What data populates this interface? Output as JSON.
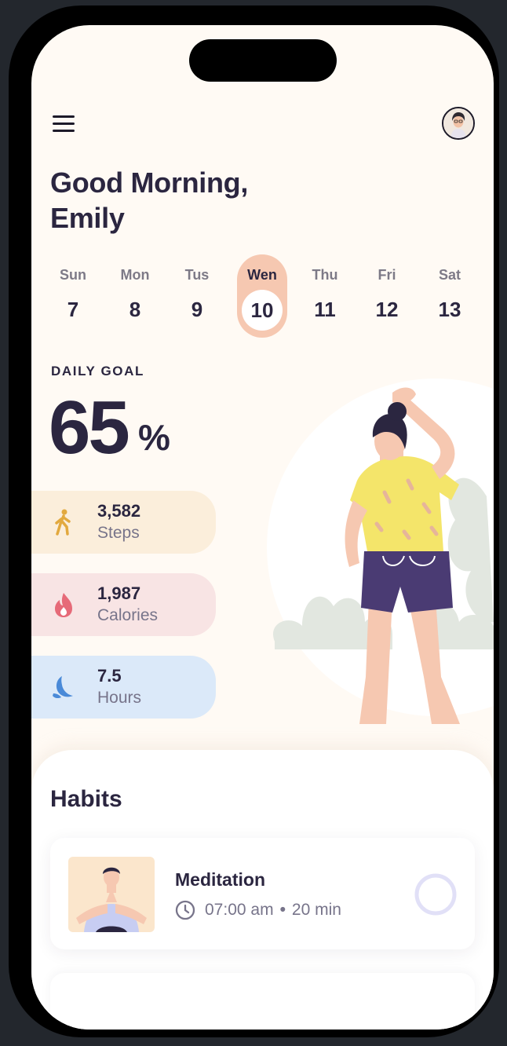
{
  "user": {
    "greeting": "Good Morning,",
    "name": "Emily"
  },
  "week": [
    {
      "name": "Sun",
      "date": "7"
    },
    {
      "name": "Mon",
      "date": "8"
    },
    {
      "name": "Tus",
      "date": "9"
    },
    {
      "name": "Wen",
      "date": "10",
      "selected": true
    },
    {
      "name": "Thu",
      "date": "11"
    },
    {
      "name": "Fri",
      "date": "12"
    },
    {
      "name": "Sat",
      "date": "13"
    }
  ],
  "goal": {
    "label": "DAILY GOAL",
    "value": "65",
    "unit": "%"
  },
  "stats": [
    {
      "value": "3,582",
      "label": "Steps",
      "icon": "walking-icon",
      "bg": "#fbeedb",
      "color": "#e2a93e"
    },
    {
      "value": "1,987",
      "label": "Calories",
      "icon": "flame-icon",
      "bg": "#f8e4e4",
      "color": "#e66a78"
    },
    {
      "value": "7.5",
      "label": "Hours",
      "icon": "moon-icon",
      "bg": "#dbe9f9",
      "color": "#4a8ad8"
    }
  ],
  "habits": {
    "title": "Habits",
    "items": [
      {
        "name": "Meditation",
        "time": "07:00 am",
        "duration": "20 min",
        "progress": 0.0
      }
    ]
  },
  "colors": {
    "accent": "#f6c8b1",
    "text": "#2b2640",
    "muted": "#77748a",
    "background": "#fffaf4"
  }
}
